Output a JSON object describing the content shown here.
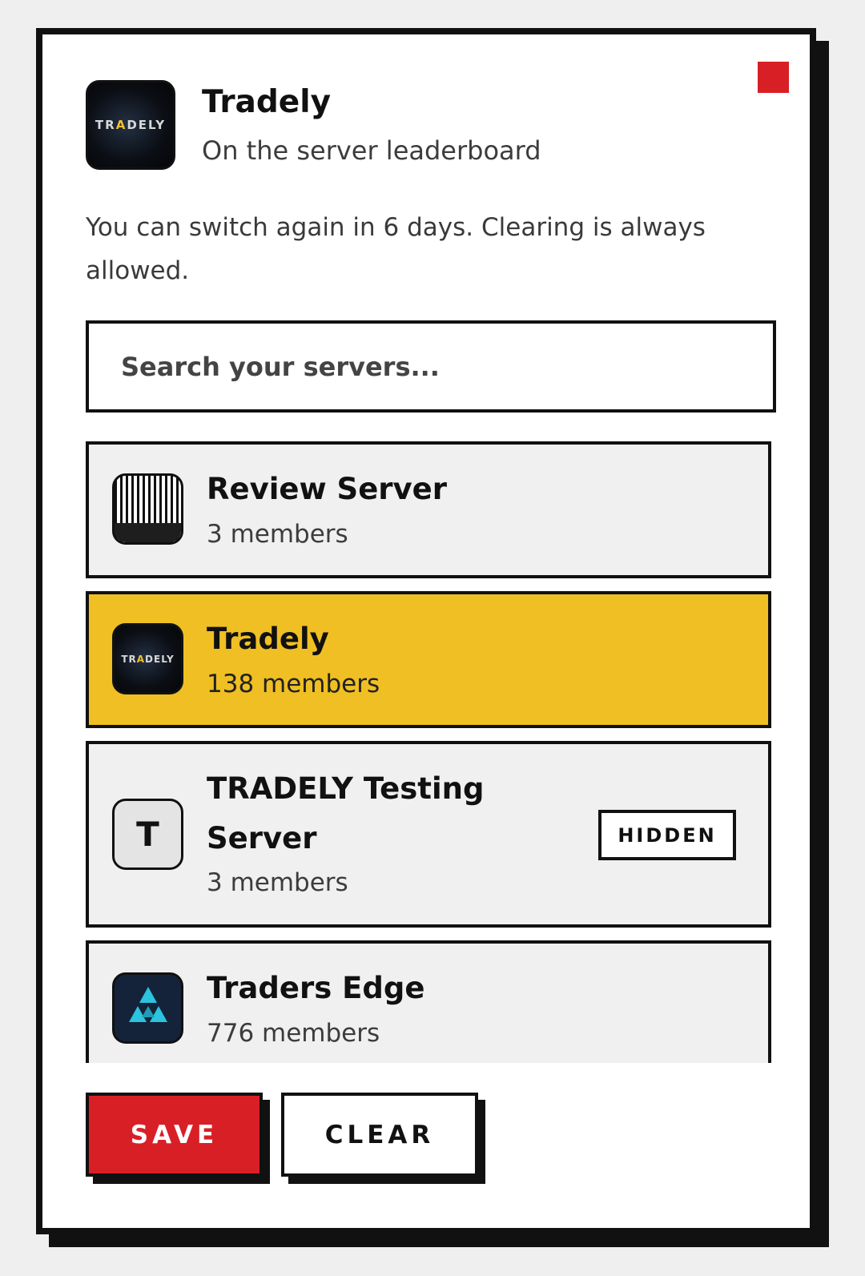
{
  "header": {
    "logo_text_before": "TR",
    "logo_text_accent": "A",
    "logo_text_after": "DELY",
    "title": "Tradely",
    "subtitle": "On the server leaderboard"
  },
  "notice": "You can switch again in 6 days. Clearing is always allowed.",
  "search": {
    "placeholder": "Search your servers..."
  },
  "servers": [
    {
      "name": "Review Server",
      "members": "3 members",
      "icon": "barcode-icon",
      "selected": false
    },
    {
      "name": "Tradely",
      "members": "138 members",
      "icon": "tradely-logo",
      "logo_text_before": "TR",
      "logo_text_accent": "A",
      "logo_text_after": "DELY",
      "selected": true
    },
    {
      "name": "TRADELY Testing Server",
      "members": "3 members",
      "icon_letter": "T",
      "badge": "HIDDEN",
      "selected": false
    },
    {
      "name": "Traders Edge",
      "members": "776 members",
      "icon": "triangle-logo",
      "selected": false
    }
  ],
  "actions": {
    "save_label": "SAVE",
    "clear_label": "CLEAR"
  },
  "colors": {
    "accent_red": "#d91f26",
    "selected_yellow": "#f0bf23",
    "border": "#111111",
    "card_bg": "#f0f0f0"
  }
}
